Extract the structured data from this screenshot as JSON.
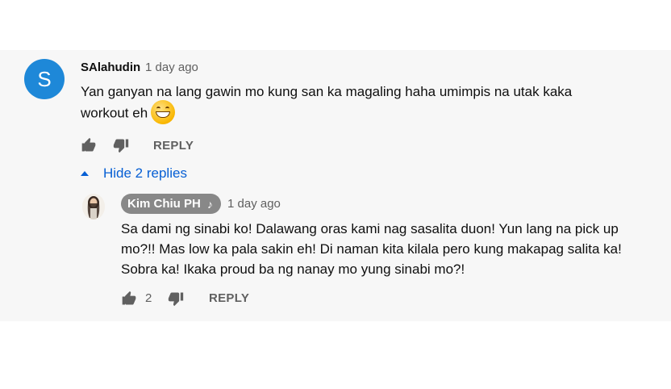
{
  "comment": {
    "avatar_letter": "S",
    "author": "SAlahudin",
    "time": "1 day ago",
    "text": "Yan ganyan na lang gawin mo kung san ka magaling haha umimpis na utak kaka workout eh",
    "emoji": "grinning-face-with-smiling-eyes",
    "reply_label": "REPLY",
    "avatar_color": "#1e88d8"
  },
  "replies_toggle": {
    "label": "Hide 2 replies",
    "color": "#065fd4"
  },
  "reply": {
    "author": "Kim Chiu PH",
    "author_badge_icon": "music-note-icon",
    "time": "1 day ago",
    "text": "Sa dami ng sinabi ko! Dalawang oras kami nag sasalita duon! Yun lang na pick up mo?!! Mas low ka pala sakin eh! Di naman kita kilala pero kung makapag salita ka! Sobra ka! Ikaka proud ba ng nanay mo yung sinabi mo?!",
    "like_count": "2",
    "reply_label": "REPLY",
    "author_chip_color": "#888888"
  }
}
